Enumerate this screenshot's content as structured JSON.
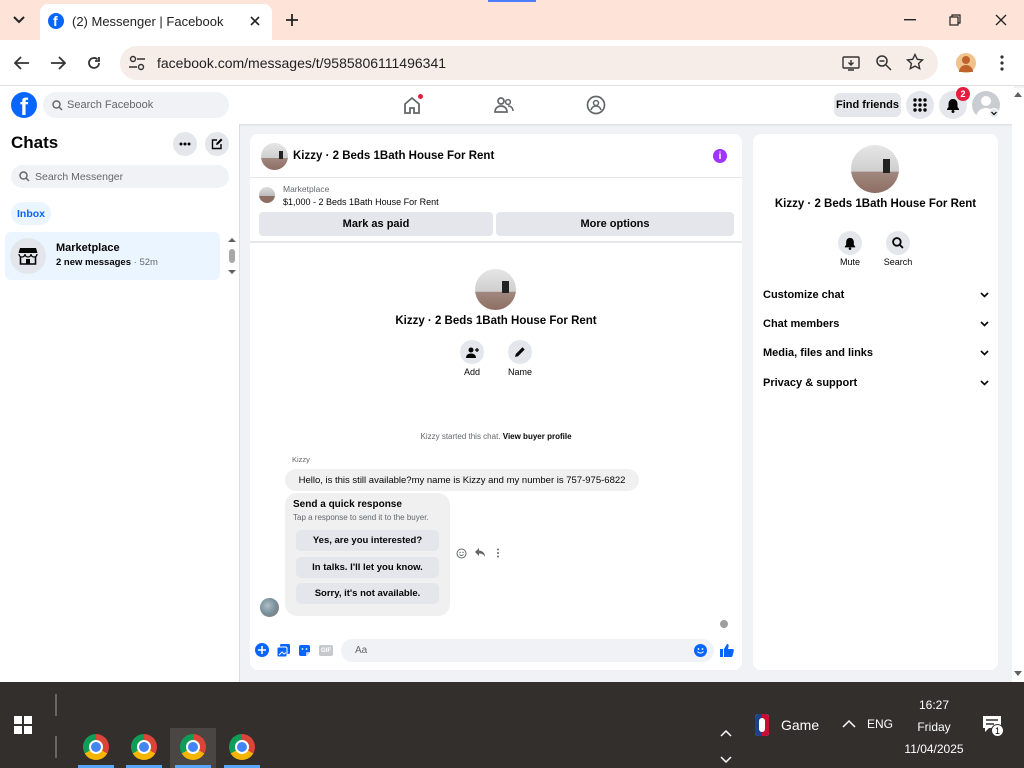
{
  "browser": {
    "tab_title": "(2) Messenger | Facebook",
    "url": "facebook.com/messages/t/9585806111496341"
  },
  "fb": {
    "search_placeholder": "Search Facebook",
    "find_friends": "Find friends",
    "notif_count": "2"
  },
  "sidebar": {
    "title": "Chats",
    "search_placeholder": "Search Messenger",
    "filter": "Inbox",
    "items": [
      {
        "name": "Marketplace",
        "preview": "2 new messages",
        "time": "52m"
      }
    ]
  },
  "chat": {
    "title": "Kizzy · 2 Beds 1Bath House For Rent",
    "listing_source": "Marketplace",
    "listing_line": "$1,000 - 2 Beds 1Bath House For Rent",
    "mark_paid": "Mark as paid",
    "more_options": "More options",
    "profile_name": "Kizzy · 2 Beds 1Bath House For Rent",
    "add_label": "Add",
    "name_label": "Name",
    "started_text": "Kizzy started this chat.",
    "view_buyer": "View buyer profile",
    "sender": "Kizzy",
    "message": "Hello, is this still available?my name is Kizzy and my number is 757-975-6822",
    "quick_title": "Send a quick response",
    "quick_sub": "Tap a response to send it to the buyer.",
    "quick_responses": [
      "Yes, are you interested?",
      "In talks. I'll let you know.",
      "Sorry, it's not available."
    ],
    "composer_placeholder": "Aa"
  },
  "right": {
    "name": "Kizzy · 2 Beds 1Bath House For Rent",
    "mute": "Mute",
    "search": "Search",
    "sections": [
      "Customize chat",
      "Chat members",
      "Media, files and links",
      "Privacy & support"
    ]
  },
  "taskbar": {
    "game": "Game",
    "lang": "ENG",
    "time": "16:27",
    "day": "Friday",
    "date": "11/04/2025",
    "notif_count": "1"
  },
  "colors": {
    "fb_blue": "#0866ff",
    "messenger_purple": "#a033ff",
    "notif_red": "#e41e3f"
  }
}
